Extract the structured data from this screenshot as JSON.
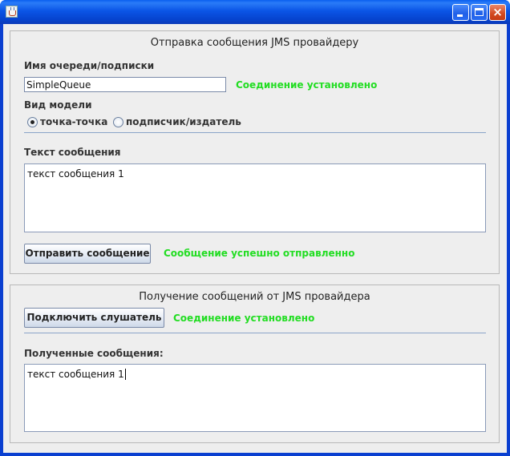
{
  "window": {
    "title": "",
    "controls": {
      "minimize": "minimize",
      "maximize": "maximize",
      "close": "×"
    }
  },
  "send_panel": {
    "title": "Отправка сообщения JMS провайдеру",
    "queue_label": "Имя очереди/подписки",
    "queue_value": "SimpleQueue",
    "connection_status": "Соединение установлено",
    "model_label": "Вид модели",
    "model_options": [
      {
        "label": "точка-точка",
        "selected": true
      },
      {
        "label": "подписчик/издатель",
        "selected": false
      }
    ],
    "message_label": "Текст сообщения",
    "message_text": "текст сообщения 1",
    "send_button": "Отправить сообщение",
    "send_status": "Сообщение успешно отправленно"
  },
  "receive_panel": {
    "title": "Получение сообщений от JMS провайдера",
    "connect_button": "Подключить слушатель",
    "connection_status": "Соединение установлено",
    "received_label": "Полученные сообщения:",
    "received_text": "текст сообщения 1"
  },
  "colors": {
    "titlebar": "#0b55e6",
    "status_green": "#22dd22",
    "panel_bg": "#eeeeee"
  }
}
